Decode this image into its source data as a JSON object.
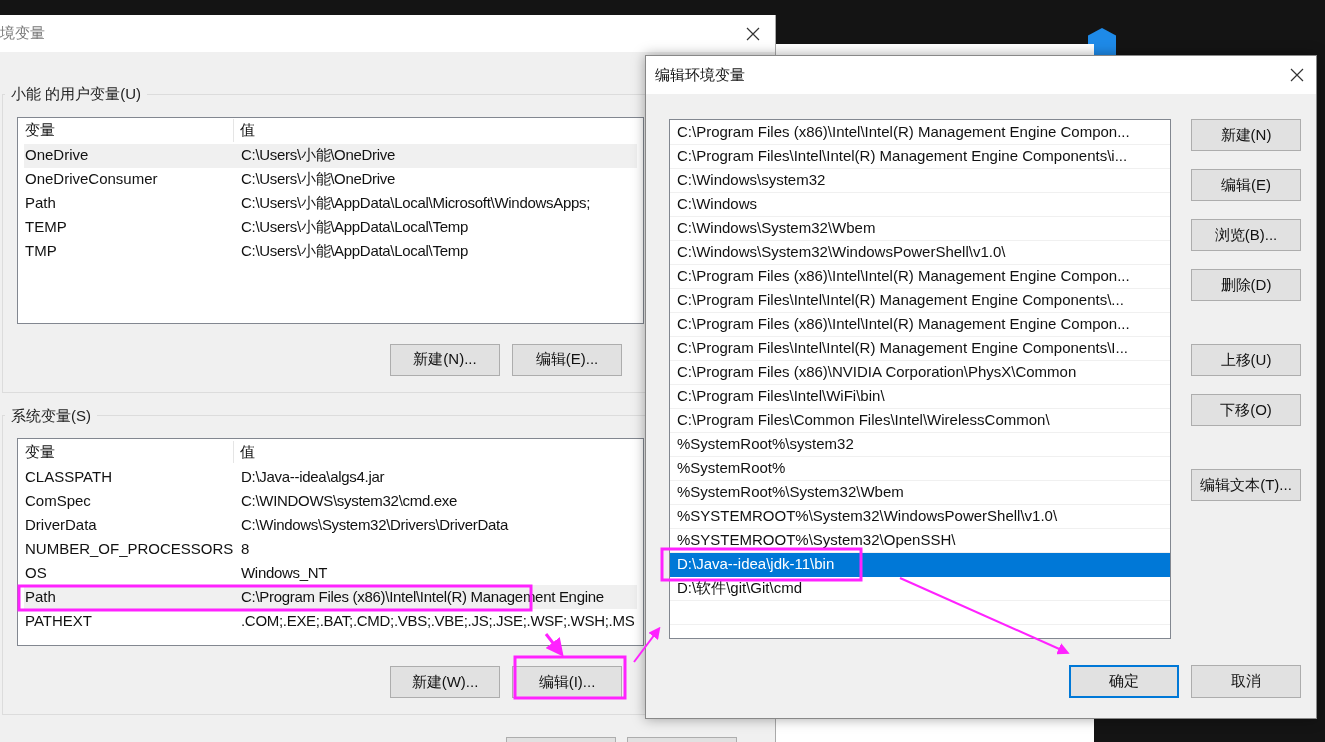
{
  "main_window": {
    "title": "境变量",
    "user_vars": {
      "label": "小能 的用户变量(U)",
      "columns": [
        "变量",
        "值"
      ],
      "rows": [
        {
          "name": "OneDrive",
          "value": "C:\\Users\\小能\\OneDrive",
          "selected": true
        },
        {
          "name": "OneDriveConsumer",
          "value": "C:\\Users\\小能\\OneDrive",
          "selected": false
        },
        {
          "name": "Path",
          "value": "C:\\Users\\小能\\AppData\\Local\\Microsoft\\WindowsApps;",
          "selected": false
        },
        {
          "name": "TEMP",
          "value": "C:\\Users\\小能\\AppData\\Local\\Temp",
          "selected": false
        },
        {
          "name": "TMP",
          "value": "C:\\Users\\小能\\AppData\\Local\\Temp",
          "selected": false
        }
      ],
      "buttons": [
        "新建(N)...",
        "编辑(E)..."
      ]
    },
    "system_vars": {
      "label": "系统变量(S)",
      "columns": [
        "变量",
        "值"
      ],
      "rows": [
        {
          "name": "CLASSPATH",
          "value": "D:\\Java--idea\\algs4.jar",
          "selected": false
        },
        {
          "name": "ComSpec",
          "value": "C:\\WINDOWS\\system32\\cmd.exe",
          "selected": false
        },
        {
          "name": "DriverData",
          "value": "C:\\Windows\\System32\\Drivers\\DriverData",
          "selected": false
        },
        {
          "name": "NUMBER_OF_PROCESSORS",
          "value": "8",
          "selected": false
        },
        {
          "name": "OS",
          "value": "Windows_NT",
          "selected": false
        },
        {
          "name": "Path",
          "value": "C:\\Program Files (x86)\\Intel\\Intel(R) Management Engine",
          "selected": true
        },
        {
          "name": "PATHEXT",
          "value": ".COM;.EXE;.BAT;.CMD;.VBS;.VBE;.JS;.JSE;.WSF;.WSH;.MS",
          "selected": false
        }
      ],
      "buttons": [
        "新建(W)...",
        "编辑(I)..."
      ]
    }
  },
  "edit_dialog": {
    "title": "编辑环境变量",
    "items": [
      {
        "text": "C:\\Program Files (x86)\\Intel\\Intel(R) Management Engine Compon...",
        "selected": false
      },
      {
        "text": "C:\\Program Files\\Intel\\Intel(R) Management Engine Components\\i...",
        "selected": false
      },
      {
        "text": "C:\\Windows\\system32",
        "selected": false
      },
      {
        "text": "C:\\Windows",
        "selected": false
      },
      {
        "text": "C:\\Windows\\System32\\Wbem",
        "selected": false
      },
      {
        "text": "C:\\Windows\\System32\\WindowsPowerShell\\v1.0\\",
        "selected": false
      },
      {
        "text": "C:\\Program Files (x86)\\Intel\\Intel(R) Management Engine Compon...",
        "selected": false
      },
      {
        "text": "C:\\Program Files\\Intel\\Intel(R) Management Engine Components\\...",
        "selected": false
      },
      {
        "text": "C:\\Program Files (x86)\\Intel\\Intel(R) Management Engine Compon...",
        "selected": false
      },
      {
        "text": "C:\\Program Files\\Intel\\Intel(R) Management Engine Components\\I...",
        "selected": false
      },
      {
        "text": "C:\\Program Files (x86)\\NVIDIA Corporation\\PhysX\\Common",
        "selected": false
      },
      {
        "text": "C:\\Program Files\\Intel\\WiFi\\bin\\",
        "selected": false
      },
      {
        "text": "C:\\Program Files\\Common Files\\Intel\\WirelessCommon\\",
        "selected": false
      },
      {
        "text": "%SystemRoot%\\system32",
        "selected": false
      },
      {
        "text": "%SystemRoot%",
        "selected": false
      },
      {
        "text": "%SystemRoot%\\System32\\Wbem",
        "selected": false
      },
      {
        "text": "%SYSTEMROOT%\\System32\\WindowsPowerShell\\v1.0\\",
        "selected": false
      },
      {
        "text": "%SYSTEMROOT%\\System32\\OpenSSH\\",
        "selected": false
      },
      {
        "text": "D:\\Java--idea\\jdk-11\\bin",
        "selected": true
      },
      {
        "text": "D:\\软件\\git\\Git\\cmd",
        "selected": false
      }
    ],
    "side_button_groups": [
      [
        "新建(N)",
        "编辑(E)",
        "浏览(B)...",
        "删除(D)"
      ],
      [
        "上移(U)",
        "下移(O)"
      ],
      [
        "编辑文本(T)..."
      ]
    ],
    "ok": "确定",
    "cancel": "取消"
  }
}
